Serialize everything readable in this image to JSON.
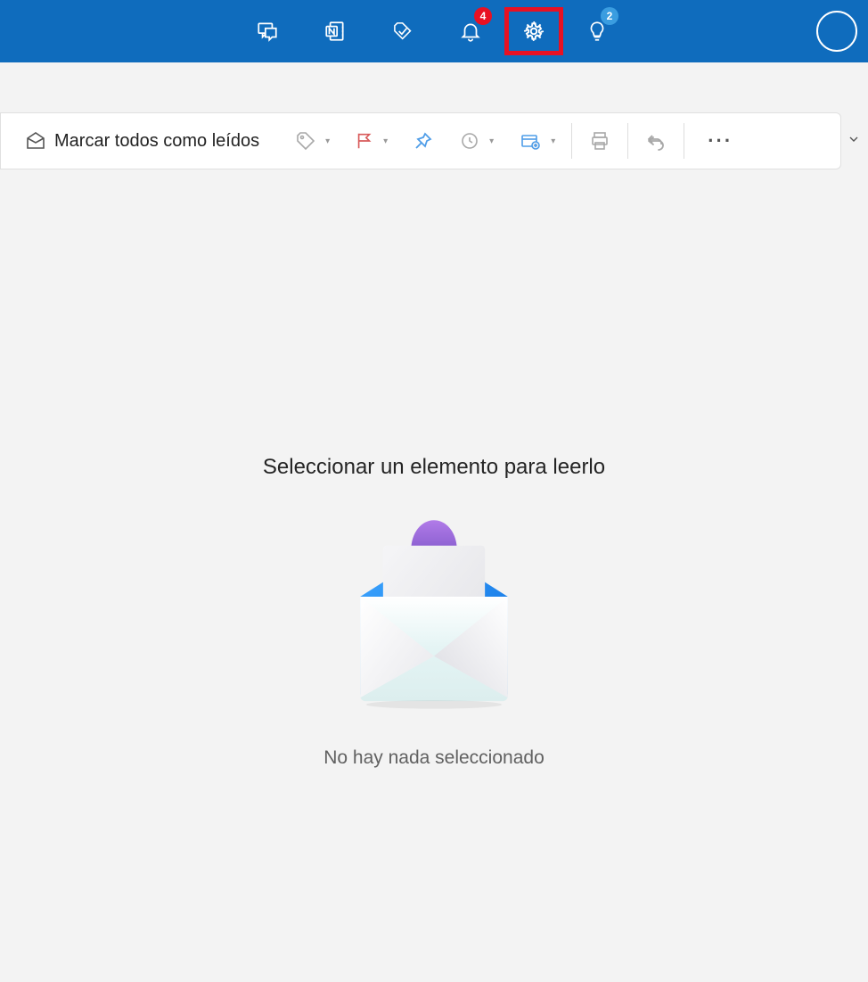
{
  "header": {
    "notifications_badge": "4",
    "tips_badge": "2"
  },
  "toolbar": {
    "mark_all_read": "Marcar todos como leídos"
  },
  "empty": {
    "title": "Seleccionar un elemento para leerlo",
    "subtitle": "No hay nada seleccionado"
  }
}
